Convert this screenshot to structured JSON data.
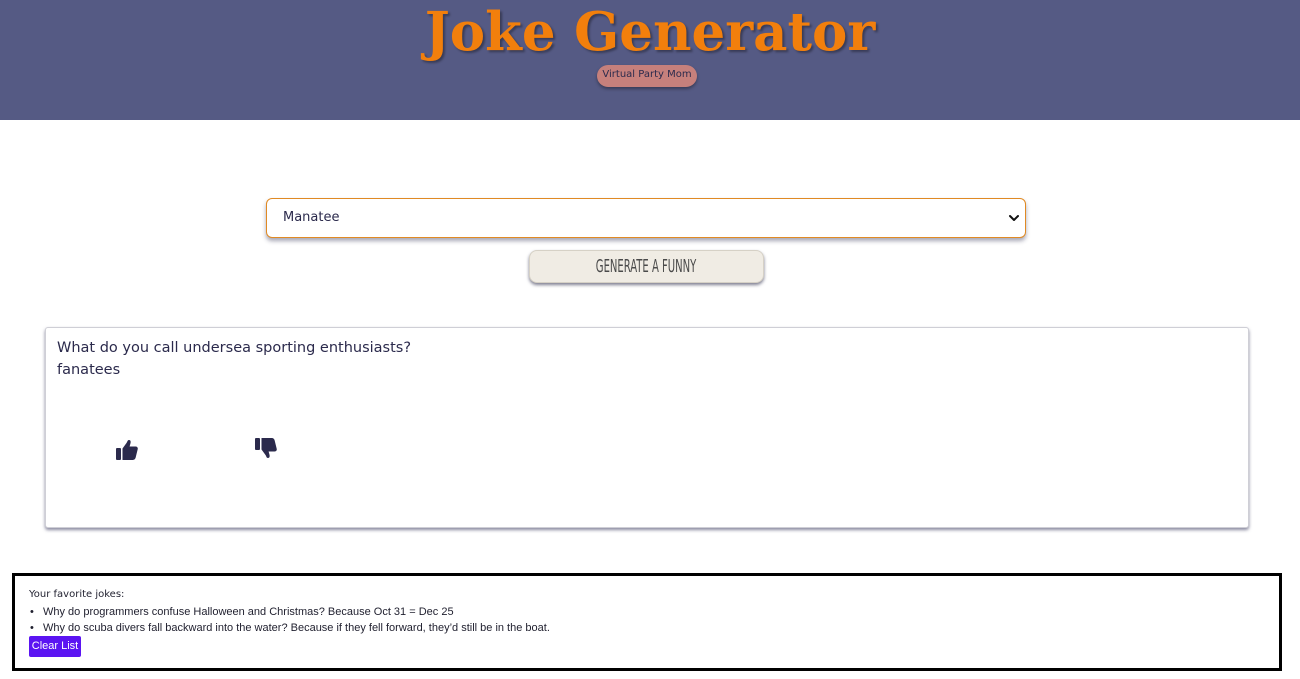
{
  "header": {
    "title": "Joke Generator",
    "badge": "Virtual Party Mom",
    "background_color": "#555a84",
    "title_color": "#f27f0c",
    "badge_color": "#c6807c"
  },
  "controls": {
    "select_value": "Manatee",
    "select_icon": "chevron-down-icon",
    "generate_label": "GENERATE A FUNNY"
  },
  "joke": {
    "question": "What do you call undersea sporting enthusiasts?",
    "answer": "fanatees",
    "like_icon": "thumbs-up-icon",
    "dislike_icon": "thumbs-down-icon"
  },
  "favorites": {
    "heading": "Your favorite jokes:",
    "items": [
      "Why do programmers confuse Halloween and Christmas? Because Oct 31 = Dec 25",
      "Why do scuba divers fall backward into the water? Because if they fell forward, they’d still be in the boat."
    ],
    "clear_label": "Clear List",
    "clear_color": "#5b14f2"
  }
}
